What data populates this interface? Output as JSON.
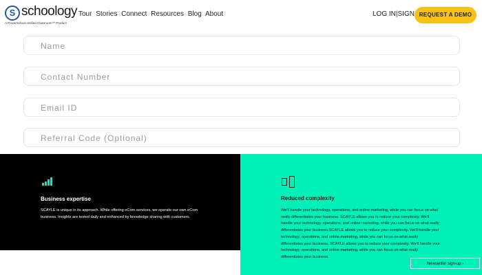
{
  "header": {
    "logo_letter": "S",
    "logo_word": "schoology",
    "logo_tagline": "A PowerSchool Unified Classroom™ Product",
    "nav": [
      "Tour",
      "Stories",
      "Connect",
      "Resources",
      "Blog",
      "About"
    ],
    "login": "LOG IN",
    "divider": "|",
    "signup": "SIGN UP",
    "cta": "REQUEST A DEMO"
  },
  "form": {
    "name_placeholder": "Name",
    "contact_placeholder": "Contact Number",
    "email_placeholder": "Email ID",
    "referral_placeholder": "Referral Code (Optional)"
  },
  "features": {
    "expertise": {
      "title": "Business expertise",
      "text": "SCAYLE is unique in its approach. While offering eCom services, we operate our own eCom business. Insights are tested daily and enhanced by knowledge sharing with customers."
    },
    "complexity": {
      "title": "Reduced complexity",
      "text": "We'll handle your technology, operations, and online marketing, while you can focus on what really differentiates your business. SCAYLE allows you to reduce your complexity. We'll handle your technology, operations, and online marketing, while you can focus on what really differentiates your business.SCAYLE allows you to reduce your complexity. We'll handle your technology, operations, and online marketing, while you can focus on what really differentiates your business. SCAYLE allows you to reduce your complexity. We'll handle your technology, operations, and online marketing, while you can focus on what really differentiates your business."
    }
  },
  "newsletter": "Newsletter sign-up",
  "newsletter_arrow": "›",
  "colors": {
    "accent_yellow": "#f6c21a",
    "teal": "#00f0b8",
    "dark": "#020202",
    "brand_blue": "#1e5aa8"
  },
  "icons": {
    "expertise": "bar-chart-icon",
    "complexity": "devices-icon"
  }
}
